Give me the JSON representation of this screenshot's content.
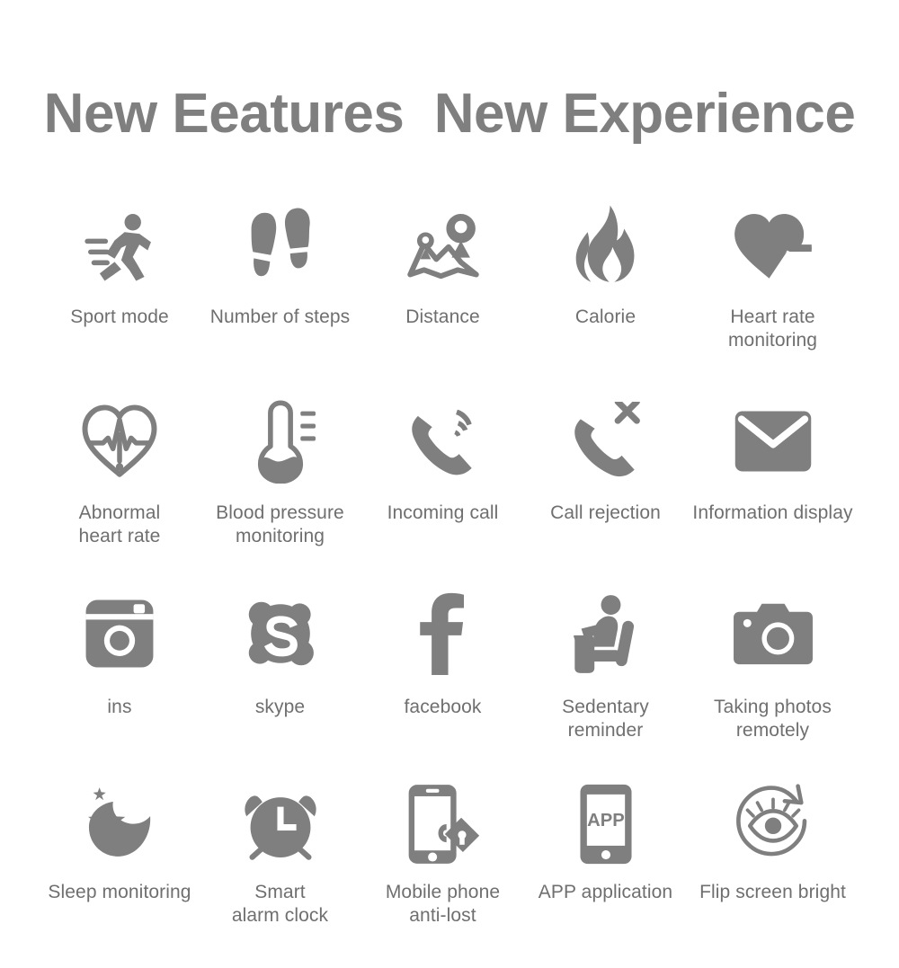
{
  "header": {
    "title": "New Eeatures  New Experience",
    "title_color": "#7f7f7f"
  },
  "theme": {
    "background": "#ffffff",
    "icon_color": "#7f7f7f",
    "label_color": "#6f6f6f"
  },
  "features": {
    "rows": [
      {
        "items": [
          {
            "icon": "running-person-icon",
            "label": "Sport mode"
          },
          {
            "icon": "footprints-icon",
            "label": "Number of steps"
          },
          {
            "icon": "map-pins-icon",
            "label": "Distance"
          },
          {
            "icon": "flame-icon",
            "label": "Calorie"
          },
          {
            "icon": "heart-pulse-filled-icon",
            "label": "Heart rate\nmonitoring"
          }
        ]
      },
      {
        "items": [
          {
            "icon": "heart-pulse-outline-alert-icon",
            "label": "Abnormal\nheart rate"
          },
          {
            "icon": "thermometer-icon",
            "label": "Blood pressure\nmonitoring"
          },
          {
            "icon": "phone-ringing-icon",
            "label": "Incoming call"
          },
          {
            "icon": "phone-reject-icon",
            "label": "Call rejection"
          },
          {
            "icon": "envelope-icon",
            "label": "Information display"
          }
        ]
      },
      {
        "items": [
          {
            "icon": "instagram-icon",
            "label": "ins"
          },
          {
            "icon": "skype-icon",
            "label": "skype"
          },
          {
            "icon": "facebook-icon",
            "label": "facebook"
          },
          {
            "icon": "sitting-person-icon",
            "label": "Sedentary\nreminder"
          },
          {
            "icon": "camera-icon",
            "label": "Taking photos\nremotely"
          }
        ]
      },
      {
        "items": [
          {
            "icon": "moon-stars-icon",
            "label": "Sleep monitoring"
          },
          {
            "icon": "alarm-clock-icon",
            "label": "Smart\nalarm clock"
          },
          {
            "icon": "phone-lock-icon",
            "label": "Mobile phone\nanti-lost"
          },
          {
            "icon": "phone-app-icon",
            "label": "APP application"
          },
          {
            "icon": "eye-rotate-icon",
            "label": "Flip screen bright"
          }
        ]
      }
    ]
  }
}
